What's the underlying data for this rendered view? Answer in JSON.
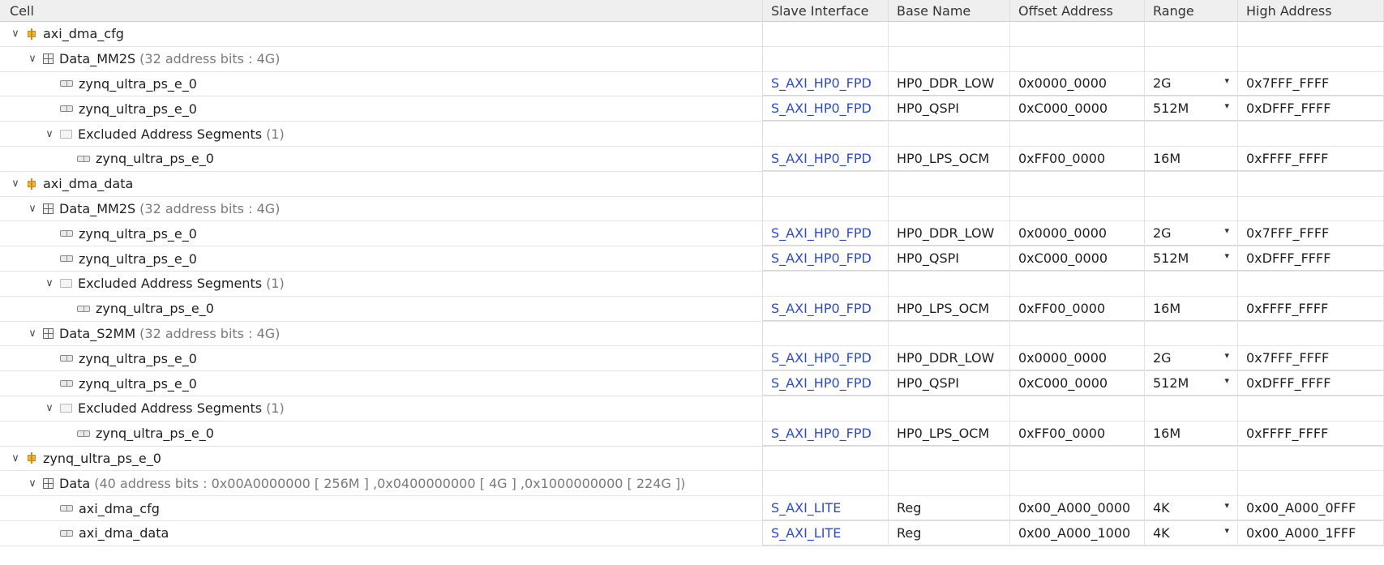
{
  "columns": [
    "Cell",
    "Slave Interface",
    "Base Name",
    "Offset Address",
    "Range",
    "High Address"
  ],
  "rows": [
    {
      "level": 0,
      "type": "master",
      "label": "axi_dma_cfg",
      "suffix": ""
    },
    {
      "level": 1,
      "type": "space",
      "label": "Data_MM2S",
      "suffix": "(32 address bits : 4G)"
    },
    {
      "level": 2,
      "type": "seg",
      "label": "zynq_ultra_ps_e_0",
      "iface": "S_AXI_HP0_FPD",
      "base": "HP0_DDR_LOW",
      "offset": "0x0000_0000",
      "range": "2G",
      "dropdown": true,
      "high": "0x7FFF_FFFF"
    },
    {
      "level": 2,
      "type": "seg",
      "label": "zynq_ultra_ps_e_0",
      "iface": "S_AXI_HP0_FPD",
      "base": "HP0_QSPI",
      "offset": "0xC000_0000",
      "range": "512M",
      "dropdown": true,
      "high": "0xDFFF_FFFF"
    },
    {
      "level": 2,
      "type": "excluded",
      "label": "Excluded Address Segments",
      "suffix": "(1)"
    },
    {
      "level": 3,
      "type": "seg",
      "label": "zynq_ultra_ps_e_0",
      "iface": "S_AXI_HP0_FPD",
      "base": "HP0_LPS_OCM",
      "offset": "0xFF00_0000",
      "range": "16M",
      "dropdown": false,
      "high": "0xFFFF_FFFF"
    },
    {
      "level": 0,
      "type": "master",
      "label": "axi_dma_data",
      "suffix": ""
    },
    {
      "level": 1,
      "type": "space",
      "label": "Data_MM2S",
      "suffix": "(32 address bits : 4G)"
    },
    {
      "level": 2,
      "type": "seg",
      "label": "zynq_ultra_ps_e_0",
      "iface": "S_AXI_HP0_FPD",
      "base": "HP0_DDR_LOW",
      "offset": "0x0000_0000",
      "range": "2G",
      "dropdown": true,
      "high": "0x7FFF_FFFF"
    },
    {
      "level": 2,
      "type": "seg",
      "label": "zynq_ultra_ps_e_0",
      "iface": "S_AXI_HP0_FPD",
      "base": "HP0_QSPI",
      "offset": "0xC000_0000",
      "range": "512M",
      "dropdown": true,
      "high": "0xDFFF_FFFF"
    },
    {
      "level": 2,
      "type": "excluded",
      "label": "Excluded Address Segments",
      "suffix": "(1)"
    },
    {
      "level": 3,
      "type": "seg",
      "label": "zynq_ultra_ps_e_0",
      "iface": "S_AXI_HP0_FPD",
      "base": "HP0_LPS_OCM",
      "offset": "0xFF00_0000",
      "range": "16M",
      "dropdown": false,
      "high": "0xFFFF_FFFF"
    },
    {
      "level": 1,
      "type": "space",
      "label": "Data_S2MM",
      "suffix": "(32 address bits : 4G)"
    },
    {
      "level": 2,
      "type": "seg",
      "label": "zynq_ultra_ps_e_0",
      "iface": "S_AXI_HP0_FPD",
      "base": "HP0_DDR_LOW",
      "offset": "0x0000_0000",
      "range": "2G",
      "dropdown": true,
      "high": "0x7FFF_FFFF"
    },
    {
      "level": 2,
      "type": "seg",
      "label": "zynq_ultra_ps_e_0",
      "iface": "S_AXI_HP0_FPD",
      "base": "HP0_QSPI",
      "offset": "0xC000_0000",
      "range": "512M",
      "dropdown": true,
      "high": "0xDFFF_FFFF"
    },
    {
      "level": 2,
      "type": "excluded",
      "label": "Excluded Address Segments",
      "suffix": "(1)"
    },
    {
      "level": 3,
      "type": "seg",
      "label": "zynq_ultra_ps_e_0",
      "iface": "S_AXI_HP0_FPD",
      "base": "HP0_LPS_OCM",
      "offset": "0xFF00_0000",
      "range": "16M",
      "dropdown": false,
      "high": "0xFFFF_FFFF"
    },
    {
      "level": 0,
      "type": "master",
      "label": "zynq_ultra_ps_e_0",
      "suffix": ""
    },
    {
      "level": 1,
      "type": "space",
      "label": "Data",
      "suffix": "(40 address bits : 0x00A0000000 [ 256M ] ,0x0400000000 [ 4G ] ,0x1000000000 [ 224G ])"
    },
    {
      "level": 2,
      "type": "seg",
      "label": "axi_dma_cfg",
      "iface": "S_AXI_LITE",
      "base": "Reg",
      "offset": "0x00_A000_0000",
      "range": "4K",
      "dropdown": true,
      "high": "0x00_A000_0FFF"
    },
    {
      "level": 2,
      "type": "seg",
      "label": "axi_dma_data",
      "iface": "S_AXI_LITE",
      "base": "Reg",
      "offset": "0x00_A000_1000",
      "range": "4K",
      "dropdown": true,
      "high": "0x00_A000_1FFF"
    }
  ]
}
